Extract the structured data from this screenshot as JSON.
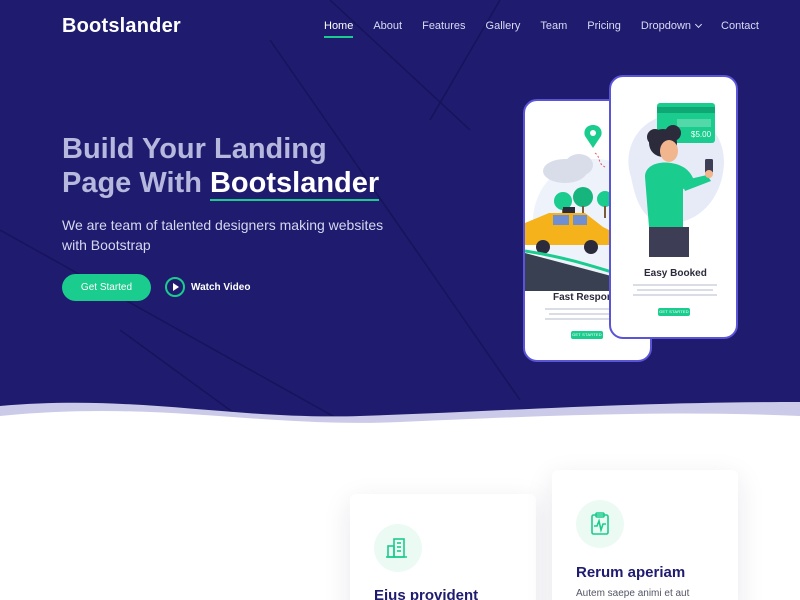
{
  "brand": {
    "name": "Bootslander"
  },
  "nav": {
    "items": [
      {
        "label": "Home"
      },
      {
        "label": "About"
      },
      {
        "label": "Features"
      },
      {
        "label": "Gallery"
      },
      {
        "label": "Team"
      },
      {
        "label": "Pricing"
      },
      {
        "label": "Dropdown"
      },
      {
        "label": "Contact"
      }
    ]
  },
  "hero": {
    "title_line1": "Build Your Landing",
    "title_line2_prefix": "Page With ",
    "title_brand": "Bootslander",
    "subtitle": "We are team of talented designers making websites with Bootstrap",
    "cta_label": "Get Started",
    "video_label": "Watch Video"
  },
  "phones": {
    "back": {
      "title": "Fast Respor",
      "button": "GET STARTED"
    },
    "front": {
      "title": "Easy Booked",
      "button": "GET STARTED",
      "price": "$5.00"
    }
  },
  "features": {
    "items": [
      {
        "title": "Eius provident",
        "text": ""
      },
      {
        "title": "Rerum aperiam",
        "text": "Autem saepe animi et aut"
      }
    ]
  },
  "colors": {
    "hero_bg": "#1f1b6e",
    "accent": "#1acc8d",
    "phone_border": "#5a54d6"
  }
}
